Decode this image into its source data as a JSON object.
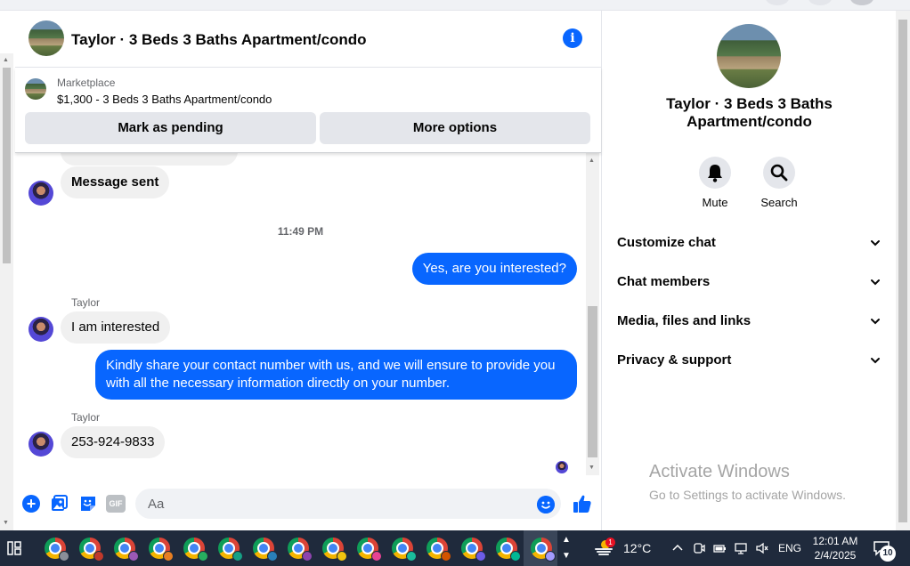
{
  "chat": {
    "title": "Taylor · 3 Beds 3 Baths Apartment/condo"
  },
  "marketplace": {
    "label": "Marketplace",
    "item": "$1,300 - 3 Beds 3 Baths Apartment/condo",
    "mark_pending_label": "Mark as pending",
    "more_options_label": "More options"
  },
  "messages": [
    {
      "from": "them",
      "text": "Message sent"
    },
    {
      "type": "timestamp",
      "text": "11:49 PM"
    },
    {
      "from": "me",
      "text": "Yes, are you interested?"
    },
    {
      "from": "them",
      "sender": "Taylor",
      "text": "I am interested"
    },
    {
      "from": "me",
      "text": "Kindly share your contact number with us, and we will ensure to provide you with all the necessary information directly on your number."
    },
    {
      "from": "them",
      "sender": "Taylor",
      "text": "253-924-9833"
    }
  ],
  "composer": {
    "placeholder": "Aa",
    "gif_label": "GIF"
  },
  "panel": {
    "title": "Taylor · 3 Beds 3 Baths Apartment/condo",
    "actions": [
      {
        "label": "Mute",
        "icon": "bell-icon"
      },
      {
        "label": "Search",
        "icon": "search-icon"
      }
    ],
    "sections": [
      {
        "label": "Customize chat"
      },
      {
        "label": "Chat members"
      },
      {
        "label": "Media, files and links"
      },
      {
        "label": "Privacy & support"
      }
    ]
  },
  "watermark": {
    "line1": "Activate Windows",
    "line2": "Go to Settings to activate Windows."
  },
  "taskbar": {
    "weather_badge": "1",
    "temperature": "12°C",
    "language": "ENG",
    "time": "12:01 AM",
    "date": "2/4/2025",
    "notification_count": "10",
    "pinned_browser_windows": 15
  },
  "colors": {
    "accent": "#0866ff",
    "bubble_in": "#f0f0f0",
    "taskbar": "#1f2a3c"
  }
}
